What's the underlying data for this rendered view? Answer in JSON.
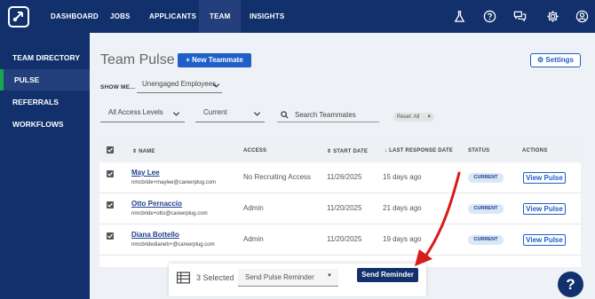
{
  "nav": {
    "items": [
      "DASHBOARD",
      "JOBS",
      "APPLICANTS",
      "TEAM",
      "INSIGHTS"
    ],
    "active": "TEAM",
    "icons": [
      "flask-icon",
      "help-circle-icon",
      "chat-icon",
      "gear-icon",
      "user-icon"
    ]
  },
  "sidebar": {
    "items": [
      "TEAM DIRECTORY",
      "PULSE",
      "REFERRALS",
      "WORKFLOWS"
    ],
    "active": "PULSE"
  },
  "page": {
    "title": "Team Pulse",
    "new_button": "+  New Teammate",
    "settings_button": "Settings"
  },
  "filters": {
    "show_label": "SHOW ME...",
    "show_value": "Unengaged Employees",
    "access_value": "All Access Levels",
    "status_value": "Current",
    "search_placeholder": "Search Teammates",
    "chip": "Reset: All"
  },
  "table": {
    "headers": [
      "NAME",
      "ACCESS",
      "START DATE",
      "LAST RESPONSE DATE",
      "STATUS",
      "ACTIONS"
    ],
    "rows": [
      {
        "name": "May Lee",
        "email": "nmcbride+maylee@careerplug.com",
        "access": "No Recruiting Access",
        "start": "11/26/2025",
        "last": "15 days ago",
        "status": "CURRENT",
        "action": "View Pulse"
      },
      {
        "name": "Otto Pernaccio",
        "email": "nmcbride+otto@careerplug.com",
        "access": "Admin",
        "start": "11/20/2025",
        "last": "21 days ago",
        "status": "CURRENT",
        "action": "View Pulse"
      },
      {
        "name": "Diana Bottello",
        "email": "nmcbridedianeb+@careerplug.com",
        "access": "Admin",
        "start": "11/20/2025",
        "last": "19 days ago",
        "status": "CURRENT",
        "action": "View Pulse"
      }
    ]
  },
  "bottom_bar": {
    "selected": "3 Selected",
    "reminder_value": "Send Pulse Reminder",
    "send_button": "Send Reminder"
  },
  "help": "?",
  "colors": {
    "nav": "#12306b",
    "accent": "#1f5fc7",
    "active_indicator": "#19a64f",
    "arrow": "#d81b1b"
  }
}
